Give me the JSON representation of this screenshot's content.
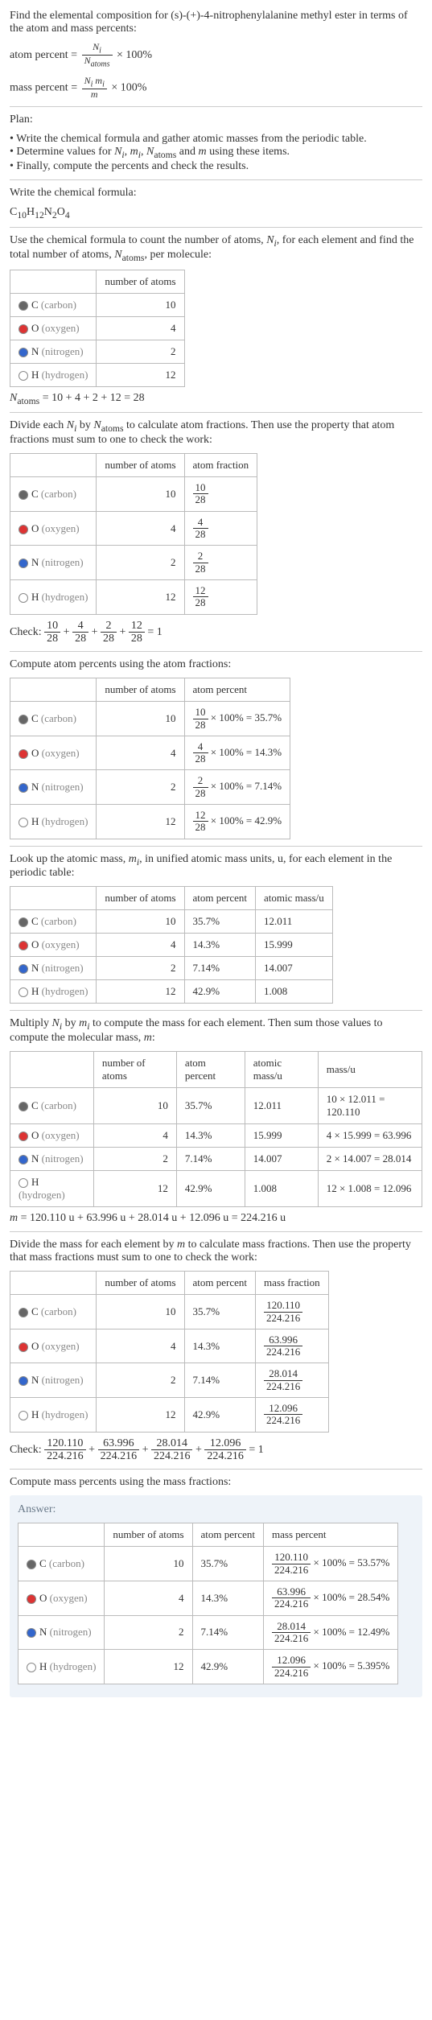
{
  "intro": "Find the elemental composition for (s)-(+)-4-nitrophenylalanine methyl ester in terms of the atom and mass percents:",
  "ap_label": "atom percent = ",
  "ap_num": "N_i",
  "ap_den": "N_atoms",
  "times100": " × 100%",
  "mp_label": "mass percent = ",
  "mp_num": "N_i m_i",
  "mp_den": "m",
  "plan_h": "Plan:",
  "plan1": "• Write the chemical formula and gather atomic masses from the periodic table.",
  "plan2": "• Determine values for N_i, m_i, N_atoms and m using these items.",
  "plan3": "• Finally, compute the percents and check the results.",
  "write_formula": "Write the chemical formula:",
  "formula_text": "C10H12N2O4",
  "use_formula": "Use the chemical formula to count the number of atoms, N_i, for each element and find the total number of atoms, N_atoms, per molecule:",
  "hdr_natoms": "number of atoms",
  "hdr_afrac": "atom fraction",
  "hdr_apct": "atom percent",
  "hdr_amass": "atomic mass/u",
  "hdr_mass": "mass/u",
  "hdr_mfrac": "mass fraction",
  "hdr_mpct": "mass percent",
  "rows": {
    "c": {
      "sym": "C",
      "name": "(carbon)",
      "n": "10"
    },
    "o": {
      "sym": "O",
      "name": "(oxygen)",
      "n": "4"
    },
    "n": {
      "sym": "N",
      "name": "(nitrogen)",
      "n": "2"
    },
    "h": {
      "sym": "H",
      "name": "(hydrogen)",
      "n": "12"
    }
  },
  "natoms_eq": "N_atoms = 10 + 4 + 2 + 12 = 28",
  "divide_text": "Divide each N_i by N_atoms to calculate atom fractions. Then use the property that atom fractions must sum to one to check the work:",
  "frac_c": {
    "n": "10",
    "d": "28"
  },
  "frac_o": {
    "n": "4",
    "d": "28"
  },
  "frac_n": {
    "n": "2",
    "d": "28"
  },
  "frac_h": {
    "n": "12",
    "d": "28"
  },
  "check1_label": "Check: ",
  "check1_eq": " = 1",
  "compute_ap": "Compute atom percents using the atom fractions:",
  "ap_c": " × 100% = 35.7%",
  "ap_o": " × 100% = 14.3%",
  "ap_n": " × 100% = 7.14%",
  "ap_h": " × 100% = 42.9%",
  "lookup_text": "Look up the atomic mass, m_i, in unified atomic mass units, u, for each element in the periodic table:",
  "apct_c": "35.7%",
  "apct_o": "14.3%",
  "apct_n": "7.14%",
  "apct_h": "42.9%",
  "amass_c": "12.011",
  "amass_o": "15.999",
  "amass_n": "14.007",
  "amass_h": "1.008",
  "mult_text": "Multiply N_i by m_i to compute the mass for each element. Then sum those values to compute the molecular mass, m:",
  "mass_c": "10 × 12.011 = 120.110",
  "mass_o": "4 × 15.999 = 63.996",
  "mass_n": "2 × 14.007 = 28.014",
  "mass_h": "12 × 1.008 = 12.096",
  "m_eq": "m = 120.110 u + 63.996 u + 28.014 u + 12.096 u = 224.216 u",
  "divmass_text": "Divide the mass for each element by m to calculate mass fractions. Then use the property that mass fractions must sum to one to check the work:",
  "mfrac_c": {
    "n": "120.110",
    "d": "224.216"
  },
  "mfrac_o": {
    "n": "63.996",
    "d": "224.216"
  },
  "mfrac_n": {
    "n": "28.014",
    "d": "224.216"
  },
  "mfrac_h": {
    "n": "12.096",
    "d": "224.216"
  },
  "check2_label": "Check: ",
  "check2_eq": " = 1",
  "compute_mp": "Compute mass percents using the mass fractions:",
  "answer_label": "Answer:",
  "mpct_c": " × 100% = 53.57%",
  "mpct_o": " × 100% = 28.54%",
  "mpct_n": " × 100% = 12.49%",
  "mpct_h": " × 100% = 5.395%"
}
